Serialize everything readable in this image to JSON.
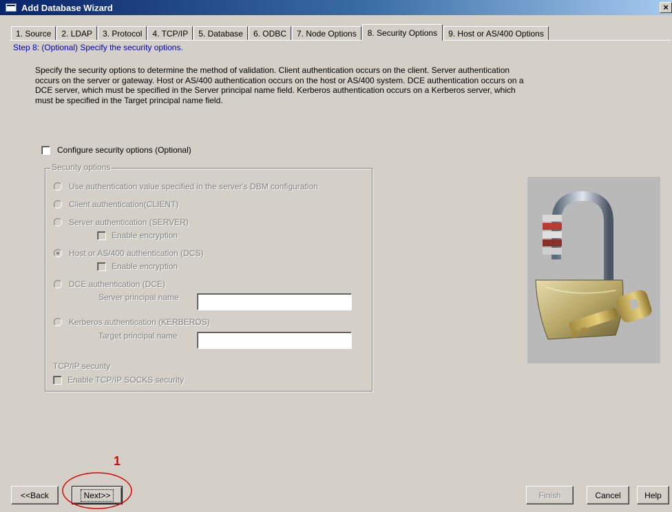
{
  "window": {
    "title": "Add Database Wizard",
    "close_label": "×"
  },
  "tabs": [
    {
      "label": "1. Source"
    },
    {
      "label": "2. LDAP"
    },
    {
      "label": "3. Protocol"
    },
    {
      "label": "4. TCP/IP"
    },
    {
      "label": "5. Database"
    },
    {
      "label": "6. ODBC"
    },
    {
      "label": "7. Node Options"
    },
    {
      "label": "8. Security Options"
    },
    {
      "label": "9. Host or AS/400 Options"
    }
  ],
  "active_tab": "8. Security Options",
  "step_text": "Step 8: (Optional) Specify the security options.",
  "description": "Specify the security options to determine the method of validation.  Client authentication occurs on the client.  Server authentication occurs on the server or gateway.  Host or AS/400 authentication occurs on the host or AS/400 system.  DCE authentication occurs on a DCE server, which must be specified in the Server principal name field.  Kerberos authentication occurs on a Kerberos server, which must be specified in the Target principal name field.",
  "configure": {
    "label": "Configure security options (Optional)",
    "checked": false
  },
  "security_group": {
    "legend": "Security options",
    "options": [
      {
        "label": "Use authentication value specified in the server's DBM configuration",
        "selected": false
      },
      {
        "label": "Client authentication(CLIENT)",
        "selected": false
      },
      {
        "label": "Server authentication (SERVER)",
        "selected": false
      },
      {
        "label": "Host or AS/400 authentication (DCS)",
        "selected": true
      },
      {
        "label": "DCE authentication (DCE)",
        "selected": false
      },
      {
        "label": "Kerberos authentication (KERBEROS)",
        "selected": false
      }
    ],
    "server_encryption_label": "Enable encryption",
    "dcs_encryption_label": "Enable encryption",
    "server_principal_label": "Server principal name",
    "server_principal_value": "",
    "target_principal_label": "Target principal name",
    "target_principal_value": "",
    "tcpip_heading": "TCP/IP security",
    "socks_label": "Enable TCP/IP SOCKS security"
  },
  "buttons": {
    "back": "<<Back",
    "next": "Next>>",
    "finish": "Finish",
    "cancel": "Cancel",
    "help": "Help"
  },
  "annotation": {
    "number": "1",
    "color": "#e00000"
  },
  "colors": {
    "title_bar": "#0a246a",
    "face": "#d4d0c8",
    "step_text": "#0000c0"
  }
}
